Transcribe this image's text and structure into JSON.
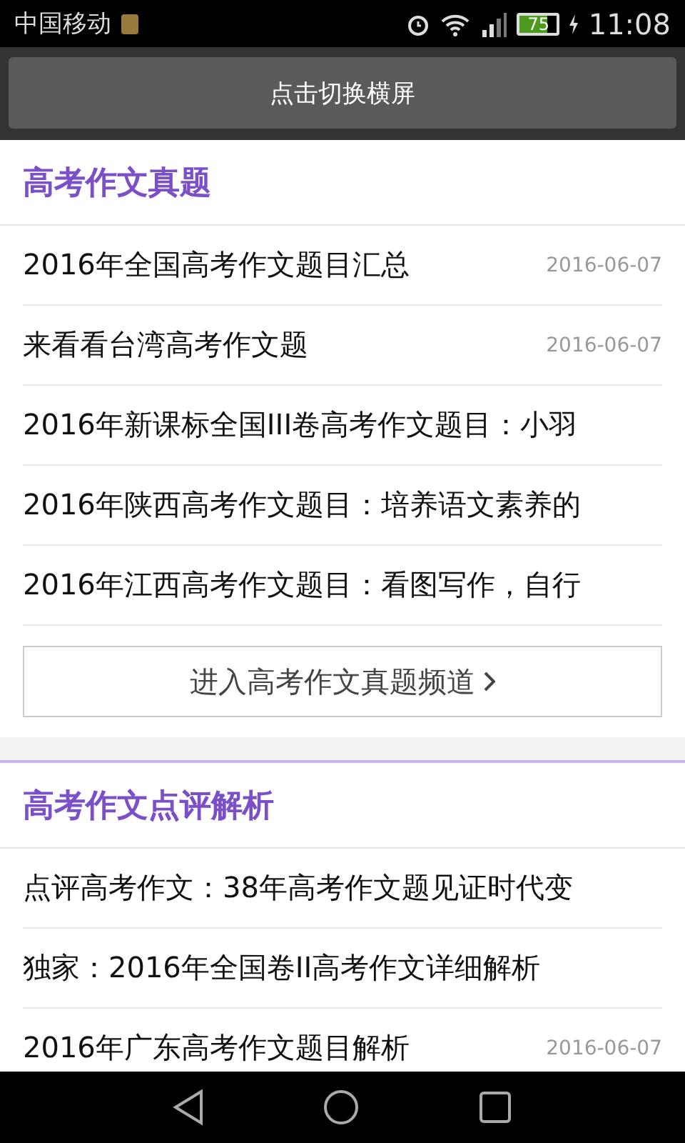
{
  "status_bar": {
    "carrier": "中国移动",
    "battery": "75",
    "time": "11:08"
  },
  "rotate_button": "点击切换横屏",
  "sections": [
    {
      "title": "高考作文真题",
      "items": [
        {
          "title": "2016年全国高考作文题目汇总",
          "date": "2016-06-07"
        },
        {
          "title": "来看看台湾高考作文题",
          "date": "2016-06-07"
        },
        {
          "title": "2016年新课标全国III卷高考作文题目：小羽"
        },
        {
          "title": "2016年陕西高考作文题目：培养语文素养的"
        },
        {
          "title": "2016年江西高考作文题目：看图写作，自行"
        }
      ],
      "more_button": "进入高考作文真题频道"
    },
    {
      "title": "高考作文点评解析",
      "items": [
        {
          "title": "点评高考作文：38年高考作文题见证时代变"
        },
        {
          "title": "独家：2016年全国卷II高考作文详细解析"
        },
        {
          "title": "2016年广东高考作文题目解析",
          "date": "2016-06-07"
        }
      ]
    }
  ]
}
